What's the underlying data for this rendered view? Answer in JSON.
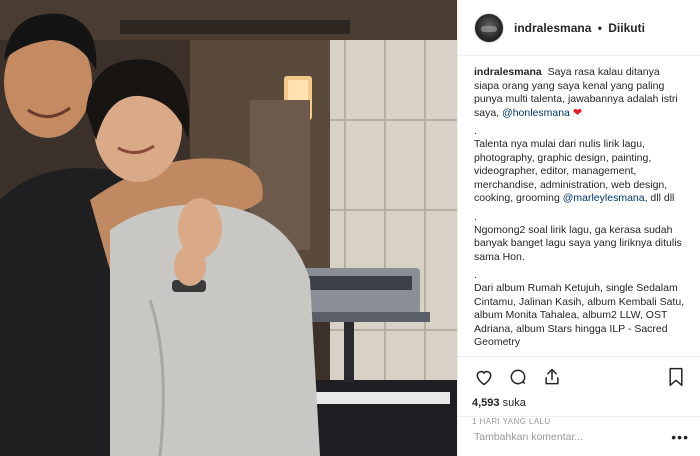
{
  "post": {
    "username": "indralesmana",
    "follow_state": "Diikuti",
    "separator": "•"
  },
  "caption": {
    "username": "indralesmana",
    "paragraph1": "Saya rasa kalau ditanya siapa orang yang saya kenal yang paling punya multi talenta, jawabannya adalah istri saya,",
    "mention1": "@honlesmana",
    "heart": "❤",
    "dot1": ".",
    "paragraph2": "Talenta nya mulai dari nulis lirik lagu, photography, graphic design, painting, videographer, editor, management, merchandise, administration, web design, cooking, grooming",
    "mention2": "@marleylesmana",
    "paragraph2_end": ", dll dll",
    "dot2": ".",
    "paragraph3": "Ngomong2 soal lirik lagu, ga kerasa sudah banyak banget lagu saya yang liriknya ditulis sama Hon.",
    "dot3": ".",
    "paragraph4": "Dari album Rumah Ketujuh, single Sedalam Cintamu, Jalinan Kasih, album Kembali Satu, album Monita Tahalea, album2 LLW, OST Adriana, album Stars hingga ILP - Sacred Geometry"
  },
  "stats": {
    "likes_count": "4,593",
    "likes_label": "suka",
    "timestamp": "1 HARI YANG LALU"
  },
  "comment": {
    "placeholder": "Tambahkan komentar...",
    "more_label": "•••"
  },
  "icons": {
    "like": "heart-icon",
    "comment": "comment-icon",
    "share": "share-icon",
    "save": "bookmark-icon"
  }
}
